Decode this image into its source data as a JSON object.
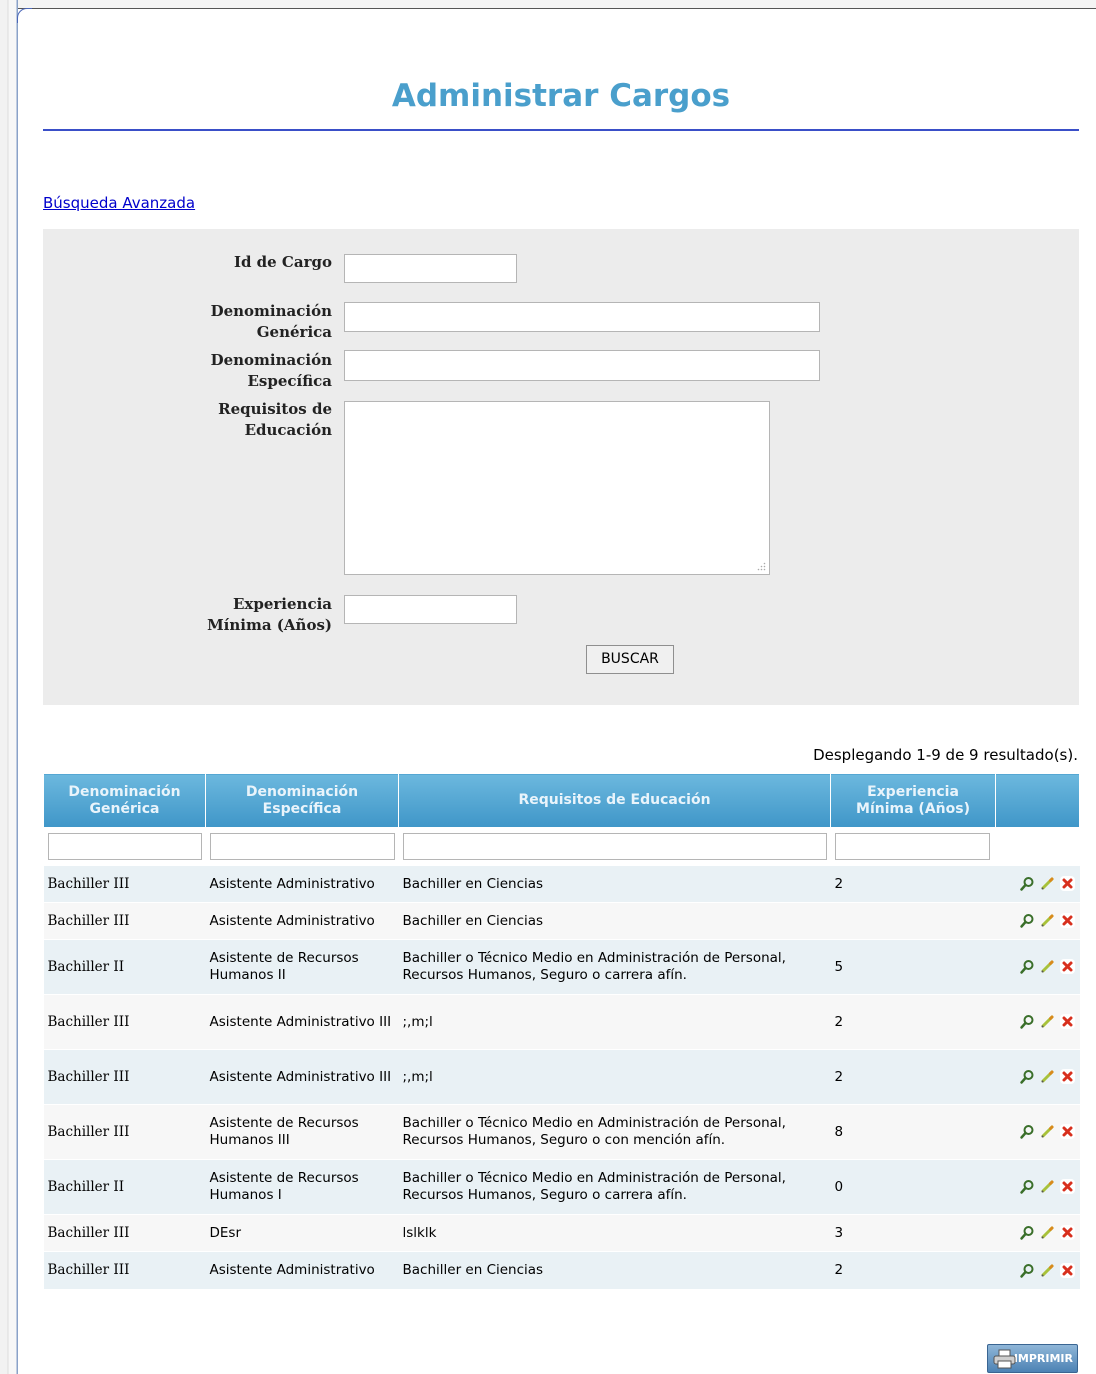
{
  "page": {
    "title": "Administrar Cargos"
  },
  "advanced_search_link": "Búsqueda Avanzada",
  "search_form": {
    "fields": [
      {
        "label_line1": "Id de Cargo",
        "label_line2": "",
        "value": ""
      },
      {
        "label_line1": "Denominación",
        "label_line2": "Genérica",
        "value": ""
      },
      {
        "label_line1": "Denominación",
        "label_line2": "Específica",
        "value": ""
      },
      {
        "label_line1": "Requisitos de",
        "label_line2": "Educación",
        "value": ""
      },
      {
        "label_line1": "Experiencia",
        "label_line2": "Mínima (Años)",
        "value": ""
      }
    ],
    "submit_label": "BUSCAR"
  },
  "results_summary": "Desplegando 1-9 de 9 resultado(s).",
  "table": {
    "columns": [
      {
        "line1": "Denominación",
        "line2": "Genérica"
      },
      {
        "line1": "Denominación",
        "line2": "Específica"
      },
      {
        "line1": "Requisitos de Educación",
        "line2": ""
      },
      {
        "line1": "Experiencia",
        "line2": "Mínima (Años)"
      },
      {
        "line1": "",
        "line2": ""
      }
    ],
    "rows": [
      {
        "generica": "Bachiller III",
        "especifica": "Asistente Administrativo",
        "requisitos": "Bachiller en Ciencias",
        "experiencia": "2"
      },
      {
        "generica": "Bachiller III",
        "especifica": "Asistente Administrativo",
        "requisitos": "Bachiller en Ciencias",
        "experiencia": ""
      },
      {
        "generica": "Bachiller II",
        "especifica": "Asistente de Recursos Humanos II",
        "requisitos": "Bachiller o Técnico Medio en Administración de Personal, Recursos Humanos, Seguro o carrera afín.",
        "experiencia": "5"
      },
      {
        "generica": "Bachiller III",
        "especifica": "Asistente Administrativo III",
        "requisitos": ";,m;l",
        "experiencia": "2"
      },
      {
        "generica": "Bachiller III",
        "especifica": "Asistente Administrativo III",
        "requisitos": ";,m;l",
        "experiencia": "2"
      },
      {
        "generica": "Bachiller III",
        "especifica": "Asistente de Recursos Humanos III",
        "requisitos": "Bachiller o Técnico Medio en Administración de Personal, Recursos Humanos, Seguro o con mención afín.",
        "experiencia": "8"
      },
      {
        "generica": "Bachiller II",
        "especifica": "Asistente de Recursos Humanos I",
        "requisitos": "Bachiller o Técnico Medio en Administración de Personal, Recursos Humanos, Seguro o carrera afín.",
        "experiencia": "0"
      },
      {
        "generica": "Bachiller III",
        "especifica": "DEsr",
        "requisitos": "lslklk",
        "experiencia": "3"
      },
      {
        "generica": "Bachiller III",
        "especifica": "Asistente Administrativo",
        "requisitos": "Bachiller en Ciencias",
        "experiencia": "2"
      }
    ],
    "row_actions": [
      "view-icon",
      "edit-icon",
      "delete-icon"
    ]
  },
  "print_button": {
    "label": "IMPRIMIR",
    "icon": "printer-icon"
  },
  "colors": {
    "title": "#4a9fcc",
    "header": "#4f9fd0",
    "link": "#0000cc",
    "rule": "#3a4fc8"
  }
}
